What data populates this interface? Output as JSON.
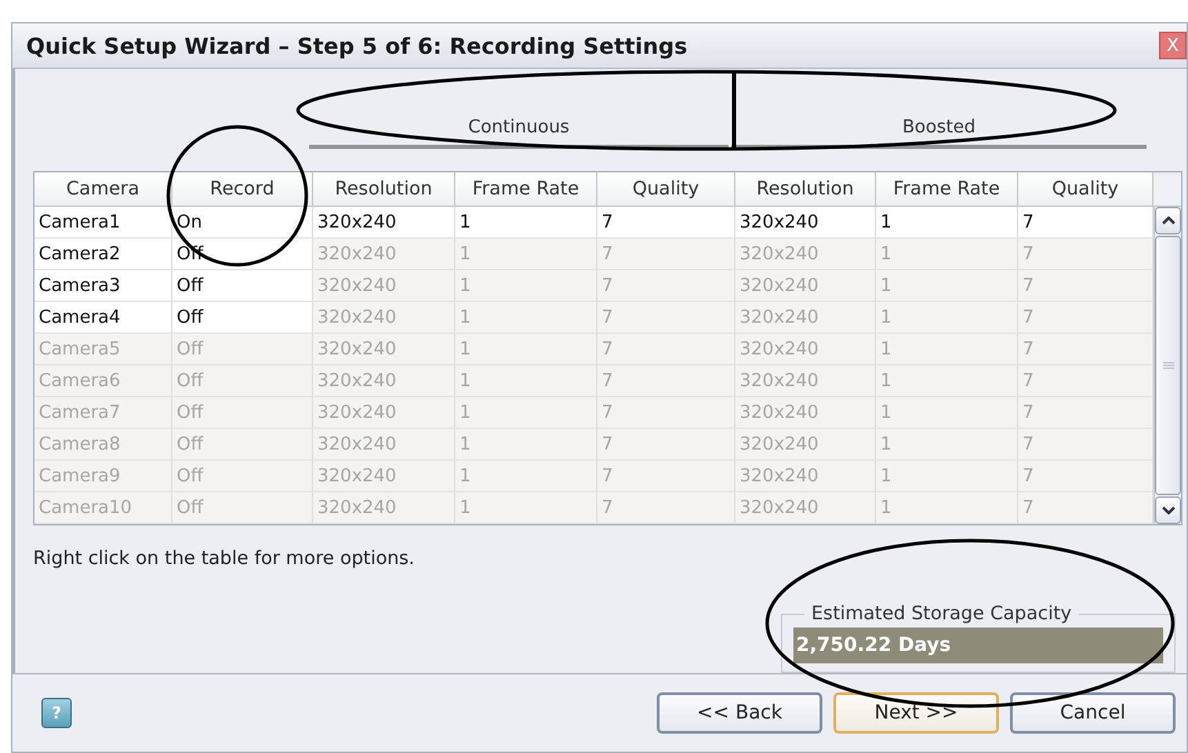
{
  "window": {
    "title": "Quick Setup Wizard – Step 5 of 6: Recording Settings",
    "close_label": "X"
  },
  "column_groups": [
    "Continuous",
    "Boosted"
  ],
  "table": {
    "columns": [
      "Camera",
      "Record",
      "Resolution",
      "Frame Rate",
      "Quality",
      "Resolution",
      "Frame Rate",
      "Quality"
    ],
    "rows": [
      {
        "cells": [
          "Camera1",
          "On",
          "320x240",
          "1",
          "7",
          "320x240",
          "1",
          "7"
        ],
        "camera_enabled": true,
        "settings_enabled": true
      },
      {
        "cells": [
          "Camera2",
          "Off",
          "320x240",
          "1",
          "7",
          "320x240",
          "1",
          "7"
        ],
        "camera_enabled": true,
        "settings_enabled": false
      },
      {
        "cells": [
          "Camera3",
          "Off",
          "320x240",
          "1",
          "7",
          "320x240",
          "1",
          "7"
        ],
        "camera_enabled": true,
        "settings_enabled": false
      },
      {
        "cells": [
          "Camera4",
          "Off",
          "320x240",
          "1",
          "7",
          "320x240",
          "1",
          "7"
        ],
        "camera_enabled": true,
        "settings_enabled": false
      },
      {
        "cells": [
          "Camera5",
          "Off",
          "320x240",
          "1",
          "7",
          "320x240",
          "1",
          "7"
        ],
        "camera_enabled": false,
        "settings_enabled": false
      },
      {
        "cells": [
          "Camera6",
          "Off",
          "320x240",
          "1",
          "7",
          "320x240",
          "1",
          "7"
        ],
        "camera_enabled": false,
        "settings_enabled": false
      },
      {
        "cells": [
          "Camera7",
          "Off",
          "320x240",
          "1",
          "7",
          "320x240",
          "1",
          "7"
        ],
        "camera_enabled": false,
        "settings_enabled": false
      },
      {
        "cells": [
          "Camera8",
          "Off",
          "320x240",
          "1",
          "7",
          "320x240",
          "1",
          "7"
        ],
        "camera_enabled": false,
        "settings_enabled": false
      },
      {
        "cells": [
          "Camera9",
          "Off",
          "320x240",
          "1",
          "7",
          "320x240",
          "1",
          "7"
        ],
        "camera_enabled": false,
        "settings_enabled": false
      },
      {
        "cells": [
          "Camera10",
          "Off",
          "320x240",
          "1",
          "7",
          "320x240",
          "1",
          "7"
        ],
        "camera_enabled": false,
        "settings_enabled": false
      }
    ]
  },
  "hint": "Right click on the table for more options.",
  "storage": {
    "title": "Estimated Storage Capacity",
    "value": "2,750.22 Days"
  },
  "help_label": "?",
  "buttons": [
    {
      "label": "<< Back",
      "default": false
    },
    {
      "label": "Next >>",
      "default": true
    },
    {
      "label": "Cancel",
      "default": false
    }
  ]
}
